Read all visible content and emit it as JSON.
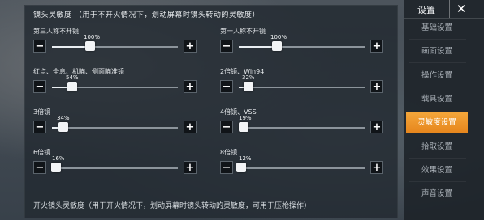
{
  "lens_section": {
    "title": "镜头灵敏度 （用于不开火情况下，划动屏幕时镜头转动的灵敏度）",
    "items": [
      {
        "label": "第三人称不开镜",
        "value": "100%",
        "level": 0.3
      },
      {
        "label": "第一人称不开镜",
        "value": "100%",
        "level": 0.3
      },
      {
        "label": "红点、全息、机瞄、侧面瞄准镜",
        "value": "54%",
        "level": 0.16
      },
      {
        "label": "2倍镜、Win94",
        "value": "32%",
        "level": 0.08
      },
      {
        "label": "3倍镜",
        "value": "34%",
        "level": 0.09
      },
      {
        "label": "4倍镜、VSS",
        "value": "19%",
        "level": 0.04
      },
      {
        "label": "6倍镜",
        "value": "16%",
        "level": 0.03
      },
      {
        "label": "8倍镜",
        "value": "12%",
        "level": 0.02
      }
    ],
    "minus_symbol": "−",
    "plus_symbol": "+"
  },
  "fire_section": {
    "title": "开火镜头灵敏度（用于开火情况下，划动屏幕时镜头转动的灵敏度，可用于压枪操作）"
  },
  "sidebar": {
    "title": "设置",
    "close_symbol": "✕",
    "items": [
      {
        "label": "基础设置"
      },
      {
        "label": "画面设置"
      },
      {
        "label": "操作设置"
      },
      {
        "label": "载具设置"
      },
      {
        "label": "灵敏度设置",
        "active": true
      },
      {
        "label": "拾取设置"
      },
      {
        "label": "效果设置"
      },
      {
        "label": "声音设置"
      }
    ]
  },
  "colors": {
    "accent": "#f0a030",
    "panel_bg": "#222931"
  }
}
